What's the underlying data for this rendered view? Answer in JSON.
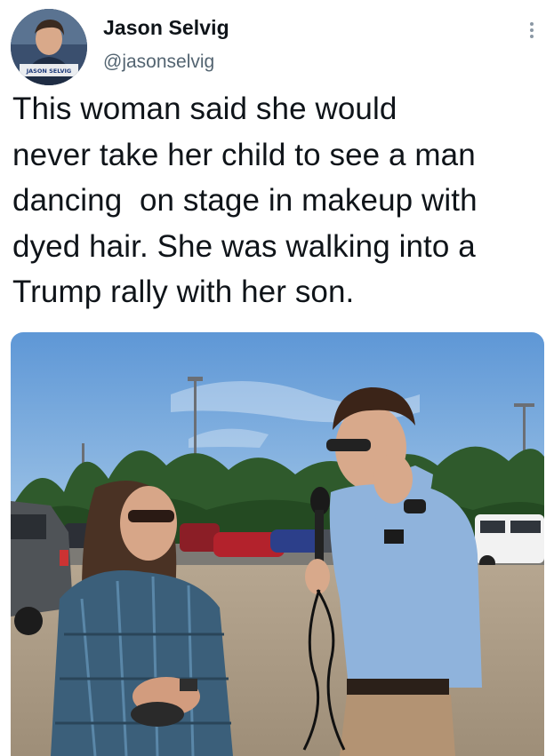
{
  "tweet": {
    "author": {
      "display_name": "Jason Selvig",
      "handle": "@jasonselvig",
      "avatar_banner_text": "JASON SELVIG"
    },
    "text": "This woman said she would\nnever take her child to see a man\ndancing  on stage in makeup with\ndyed hair. She was walking into a\nTrump rally with her son.",
    "more_icon": "more-vertical-icon"
  },
  "colors": {
    "text": "#0f1419",
    "secondary": "#536471",
    "sky": "#6fa6de"
  }
}
